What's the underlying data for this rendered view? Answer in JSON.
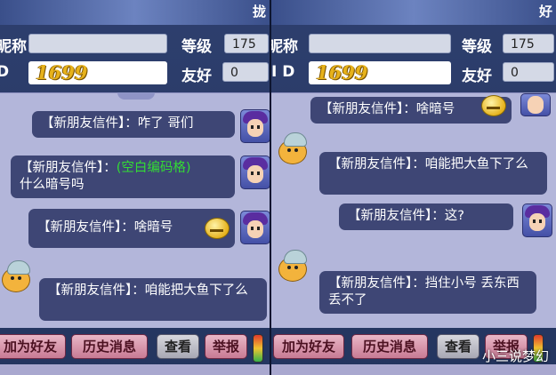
{
  "left": {
    "top_glyph": "拢",
    "nickname_label": "昵称",
    "nickname_value": "",
    "level_label": "等级",
    "level_value": "175",
    "id_label": "D",
    "id_value": "1699",
    "friendship_label": "友好",
    "friendship_value": "0",
    "messages": [
      {
        "sender": "【新朋友信件】",
        "sep": "：",
        "text": "咋了 哥们"
      },
      {
        "sender": "【新朋友信件】",
        "sep": "：",
        "name": "(空白编码格)",
        "text": "什么暗号吗"
      },
      {
        "sender": "【新朋友信件】",
        "sep": "：",
        "text": "啥暗号"
      },
      {
        "sender": "【新朋友信件】",
        "sep": "：",
        "text": "咱能把大鱼下了么"
      }
    ],
    "buttons": {
      "add_friend": "加为好友",
      "history": "历史消息",
      "view": "查看",
      "report": "举报"
    }
  },
  "right": {
    "top_glyph": "好",
    "nickname_label": "昵称",
    "nickname_value": "",
    "level_label": "等级",
    "level_value": "175",
    "id_label": "I D",
    "id_value": "1699",
    "friendship_label": "友好",
    "friendship_value": "0",
    "messages": [
      {
        "sender": "【新朋友信件】",
        "sep": "：",
        "text": "啥暗号"
      },
      {
        "sender": "【新朋友信件】",
        "sep": "：",
        "text": "咱能把大鱼下了么"
      },
      {
        "sender": "【新朋友信件】",
        "sep": "：",
        "text": "这?"
      },
      {
        "sender": "【新朋友信件】",
        "sep": "：",
        "text": "挡住小号 丢东西丢不了"
      }
    ],
    "buttons": {
      "add_friend": "加为好友",
      "history": "历史消息",
      "view": "查看",
      "report": "举报"
    }
  },
  "watermark": "小三说梦幻",
  "colors": {
    "chat_bg": "#b3b6da",
    "bubble": "#3e4675",
    "score": "#e7b21a",
    "name_green": "#33dd33",
    "button": "#c87a94"
  },
  "icons": [
    "hero-avatar-icon",
    "pet-avatar-icon",
    "sweat-emoji-icon"
  ]
}
